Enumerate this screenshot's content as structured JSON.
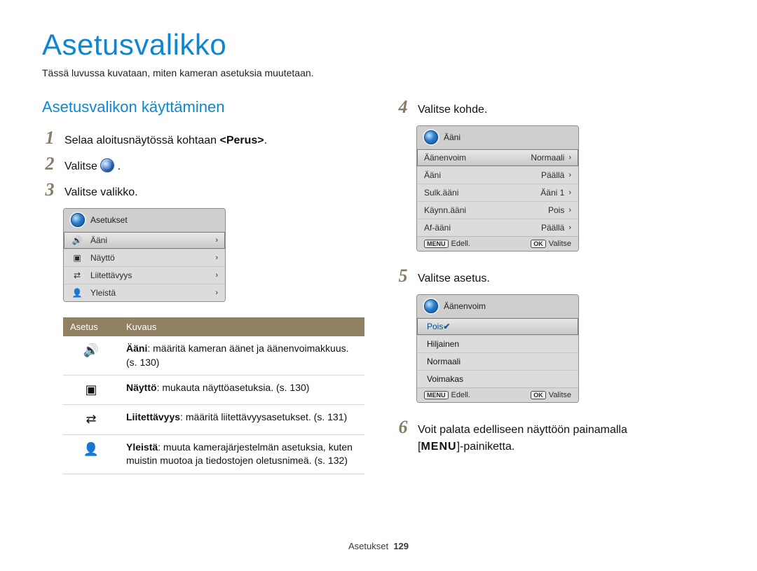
{
  "title": "Asetusvalikko",
  "intro": "Tässä luvussa kuvataan, miten kameran asetuksia muutetaan.",
  "section_heading": "Asetusvalikon käyttäminen",
  "steps": {
    "s1": {
      "num": "1",
      "pre": "Selaa aloitusnäytössä kohtaan ",
      "bold": "<Perus>",
      "post": "."
    },
    "s2": {
      "num": "2",
      "pre": "Valitse ",
      "post": "."
    },
    "s3": {
      "num": "3",
      "text": "Valitse valikko."
    },
    "s4": {
      "num": "4",
      "text": "Valitse kohde."
    },
    "s5": {
      "num": "5",
      "text": "Valitse asetus."
    },
    "s6": {
      "num": "6",
      "text_a": "Voit palata edelliseen näyttöön painamalla",
      "text_b": "-painiketta.",
      "menu": "MENU"
    }
  },
  "menu_box_1": {
    "title": "Asetukset",
    "rows": [
      {
        "icon": "speaker",
        "label": "Ääni",
        "selected": true
      },
      {
        "icon": "screen",
        "label": "Näyttö"
      },
      {
        "icon": "connect",
        "label": "Liitettävyys"
      },
      {
        "icon": "person",
        "label": "Yleistä"
      }
    ]
  },
  "desc_table": {
    "head": {
      "c1": "Asetus",
      "c2": "Kuvaus"
    },
    "rows": [
      {
        "icon": "speaker",
        "name": "Ääni",
        "desc": ": määritä kameran äänet ja äänenvoimakkuus. (s. 130)"
      },
      {
        "icon": "screen",
        "name": "Näyttö",
        "desc": ": mukauta näyttöasetuksia. (s. 130)"
      },
      {
        "icon": "connect",
        "name": "Liitettävyys",
        "desc": ": määritä liitettävyysasetukset. (s. 131)"
      },
      {
        "icon": "person",
        "name": "Yleistä",
        "desc": ": muuta kamerajärjestelmän asetuksia, kuten muistin muotoa ja tiedostojen oletusnimeä. (s. 132)"
      }
    ]
  },
  "menu_box_2": {
    "title": "Ääni",
    "rows": [
      {
        "label": "Äänenvoim",
        "value": "Normaali",
        "selected": true
      },
      {
        "label": "Ääni",
        "value": "Päällä"
      },
      {
        "label": "Sulk.ääni",
        "value": "Ääni 1"
      },
      {
        "label": "Käynn.ääni",
        "value": "Pois"
      },
      {
        "label": "Af-ääni",
        "value": "Päällä"
      }
    ],
    "foot": {
      "left_key": "MENU",
      "left": "Edell.",
      "right_key": "OK",
      "right": "Valitse"
    }
  },
  "menu_box_3": {
    "title": "Äänenvoim",
    "rows": [
      {
        "label": "Pois",
        "selected": true
      },
      {
        "label": "Hiljainen"
      },
      {
        "label": "Normaali"
      },
      {
        "label": "Voimakas"
      }
    ],
    "foot": {
      "left_key": "MENU",
      "left": "Edell.",
      "right_key": "OK",
      "right": "Valitse"
    }
  },
  "footer": {
    "label": "Asetukset",
    "page": "129"
  },
  "icons": {
    "speaker": "🔊",
    "screen": "▣",
    "connect": "⇄",
    "person": "👤"
  }
}
